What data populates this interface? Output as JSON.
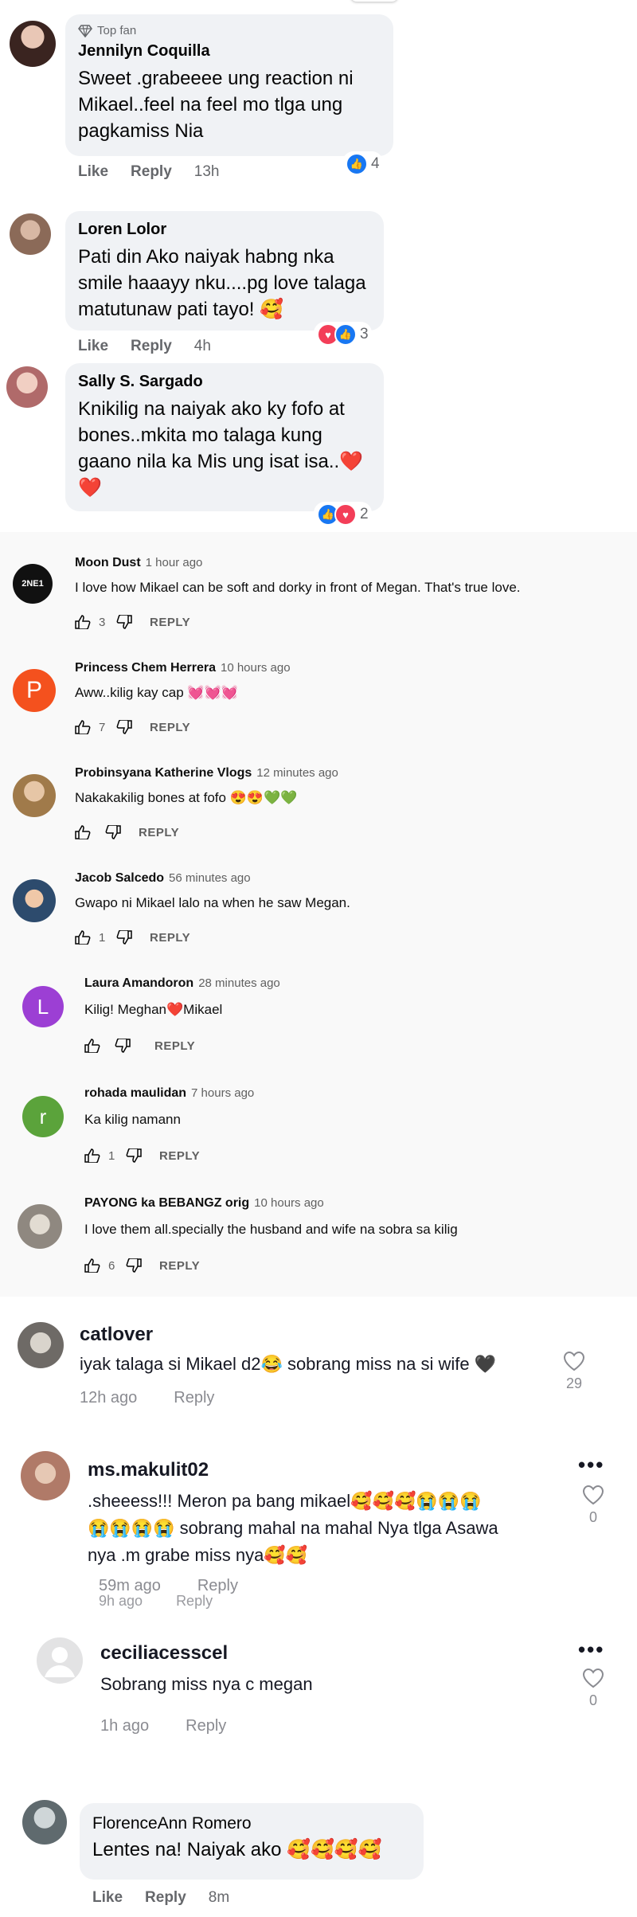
{
  "fb": {
    "top_fan_label": "Top fan",
    "like_label": "Like",
    "reply_label": "Reply",
    "comments": [
      {
        "name": "Jennilyn Coquilla",
        "lines": [
          "Sweet .grabeeee ung reaction ni",
          "Mikael..feel na feel mo tlga ung",
          "pagkamiss Nia"
        ],
        "time": "13h",
        "reactions": "4"
      },
      {
        "name": "Loren Lolor",
        "lines": [
          "Pati din Ako naiyak habng nka",
          "smile haaayy nku....pg love talaga",
          "matutunaw pati tayo! 🥰"
        ],
        "time": "4h",
        "reactions": "3"
      },
      {
        "name": "Sally S. Sargado",
        "lines": [
          "Knikilig na naiyak ako ky fofo at",
          "bones..mkita mo talaga kung",
          "gaano nila ka Mis ung isat isa..❤️",
          "❤️"
        ],
        "reactions": "2"
      }
    ]
  },
  "yt": {
    "reply_label": "REPLY",
    "comments": [
      {
        "name": "Moon Dust",
        "ago": "1 hour ago",
        "text": "I love how Mikael can be soft and dorky in front of Megan. That's true love.",
        "likes": "3",
        "avatar_text": "2NE1",
        "avatar_color": "#111111"
      },
      {
        "name": "Princess Chem Herrera",
        "ago": "10 hours ago",
        "text": "Aww..kilig kay cap 💓💓💓",
        "likes": "7",
        "avatar_text": "P",
        "avatar_color": "#f4511e"
      },
      {
        "name": "Probinsyana Katherine Vlogs",
        "ago": "12 minutes ago",
        "text": "Nakakakilig bones at fofo 😍😍💚💚",
        "likes": "",
        "avatar_text": "",
        "avatar_color": "#c9a07a"
      },
      {
        "name": "Jacob Salcedo",
        "ago": "56 minutes ago",
        "text": "Gwapo ni Mikael lalo na when he saw Megan.",
        "likes": "1",
        "avatar_text": "",
        "avatar_color": "#4a6a8a"
      },
      {
        "name": "Laura Amandoron",
        "ago": "28 minutes ago",
        "text": "Kilig! Meghan❤️Mikael",
        "likes": "",
        "avatar_text": "L",
        "avatar_color": "#9c3fd4"
      },
      {
        "name": "rohada maulidan",
        "ago": "7 hours ago",
        "text": "Ka kilig namann",
        "likes": "1",
        "avatar_text": "r",
        "avatar_color": "#5ba33b"
      },
      {
        "name": "PAYONG ka BEBANGZ orig",
        "ago": "10 hours ago",
        "text": "I love them all.specially the husband and wife na sobra sa kilig",
        "likes": "6",
        "avatar_text": "",
        "avatar_color": "#b5b0a8"
      }
    ]
  },
  "tt": {
    "reply_label": "Reply",
    "comments": [
      {
        "name": "catlover",
        "text": "iyak talaga si Mikael d2😂 sobrang miss na si wife 🖤",
        "time": "12h ago",
        "likes": "29"
      },
      {
        "name": "ms.makulit02",
        "lines": [
          ".sheeess!!! Meron pa bang mikael🥰🥰🥰😭😭😭",
          "😭😭😭😭 sobrang mahal na mahal Nya tlga Asawa",
          "nya .m grabe miss nya🥰🥰"
        ],
        "time": "59m ago",
        "likes": "0",
        "ghost_time": "9h ago",
        "ghost_reply": "Reply"
      },
      {
        "name": "ceciliacesscel",
        "text": "Sobrang miss nya c megan",
        "time": "1h ago",
        "likes": "0"
      }
    ]
  },
  "fb2": {
    "name": "FlorenceAnn Romero",
    "text": "Lentes na! Naiyak ako 🥰🥰🥰🥰",
    "like_label": "Like",
    "reply_label": "Reply",
    "time": "8m"
  }
}
